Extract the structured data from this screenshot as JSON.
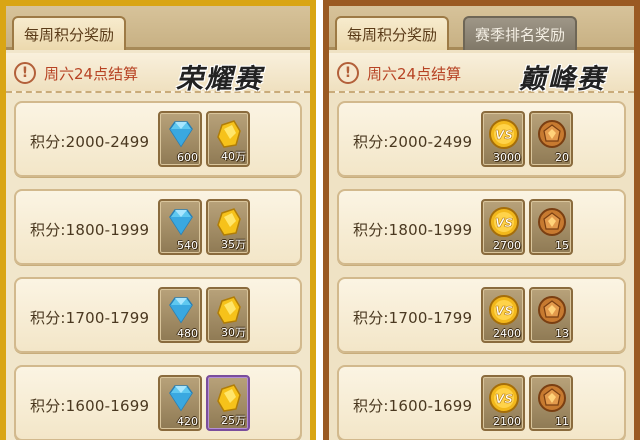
{
  "left": {
    "tabs": [
      {
        "label": "每周积分奖励",
        "active": true
      }
    ],
    "notice": "周六24点结算",
    "mode_title": "荣耀赛",
    "rows": [
      {
        "label": "积分:2000-2499",
        "rewards": [
          {
            "icon": "diamond-icon",
            "count": "600"
          },
          {
            "icon": "gold-icon",
            "count": "40万"
          }
        ]
      },
      {
        "label": "积分:1800-1999",
        "rewards": [
          {
            "icon": "diamond-icon",
            "count": "540"
          },
          {
            "icon": "gold-icon",
            "count": "35万"
          }
        ]
      },
      {
        "label": "积分:1700-1799",
        "rewards": [
          {
            "icon": "diamond-icon",
            "count": "480"
          },
          {
            "icon": "gold-icon",
            "count": "30万"
          }
        ]
      },
      {
        "label": "积分:1600-1699",
        "rewards": [
          {
            "icon": "diamond-icon",
            "count": "420"
          },
          {
            "icon": "gold-icon",
            "count": "25万"
          }
        ]
      }
    ]
  },
  "right": {
    "tabs": [
      {
        "label": "每周积分奖励",
        "active": true
      },
      {
        "label": "赛季排名奖励",
        "active": false
      }
    ],
    "notice": "周六24点结算",
    "mode_title": "巅峰赛",
    "rows": [
      {
        "label": "积分:2000-2499",
        "rewards": [
          {
            "icon": "vs-coin-icon",
            "count": "3000"
          },
          {
            "icon": "chest-icon",
            "count": "20"
          }
        ]
      },
      {
        "label": "积分:1800-1999",
        "rewards": [
          {
            "icon": "vs-coin-icon",
            "count": "2700"
          },
          {
            "icon": "chest-icon",
            "count": "15"
          }
        ]
      },
      {
        "label": "积分:1700-1799",
        "rewards": [
          {
            "icon": "vs-coin-icon",
            "count": "2400"
          },
          {
            "icon": "chest-icon",
            "count": "13"
          }
        ]
      },
      {
        "label": "积分:1600-1699",
        "rewards": [
          {
            "icon": "vs-coin-icon",
            "count": "2100"
          },
          {
            "icon": "chest-icon",
            "count": "11"
          }
        ]
      }
    ]
  },
  "colors": {
    "left_frame": "#d9a514",
    "right_frame": "#9a5a22",
    "notice_text": "#b74324",
    "parchment": "#f1e6cb"
  }
}
